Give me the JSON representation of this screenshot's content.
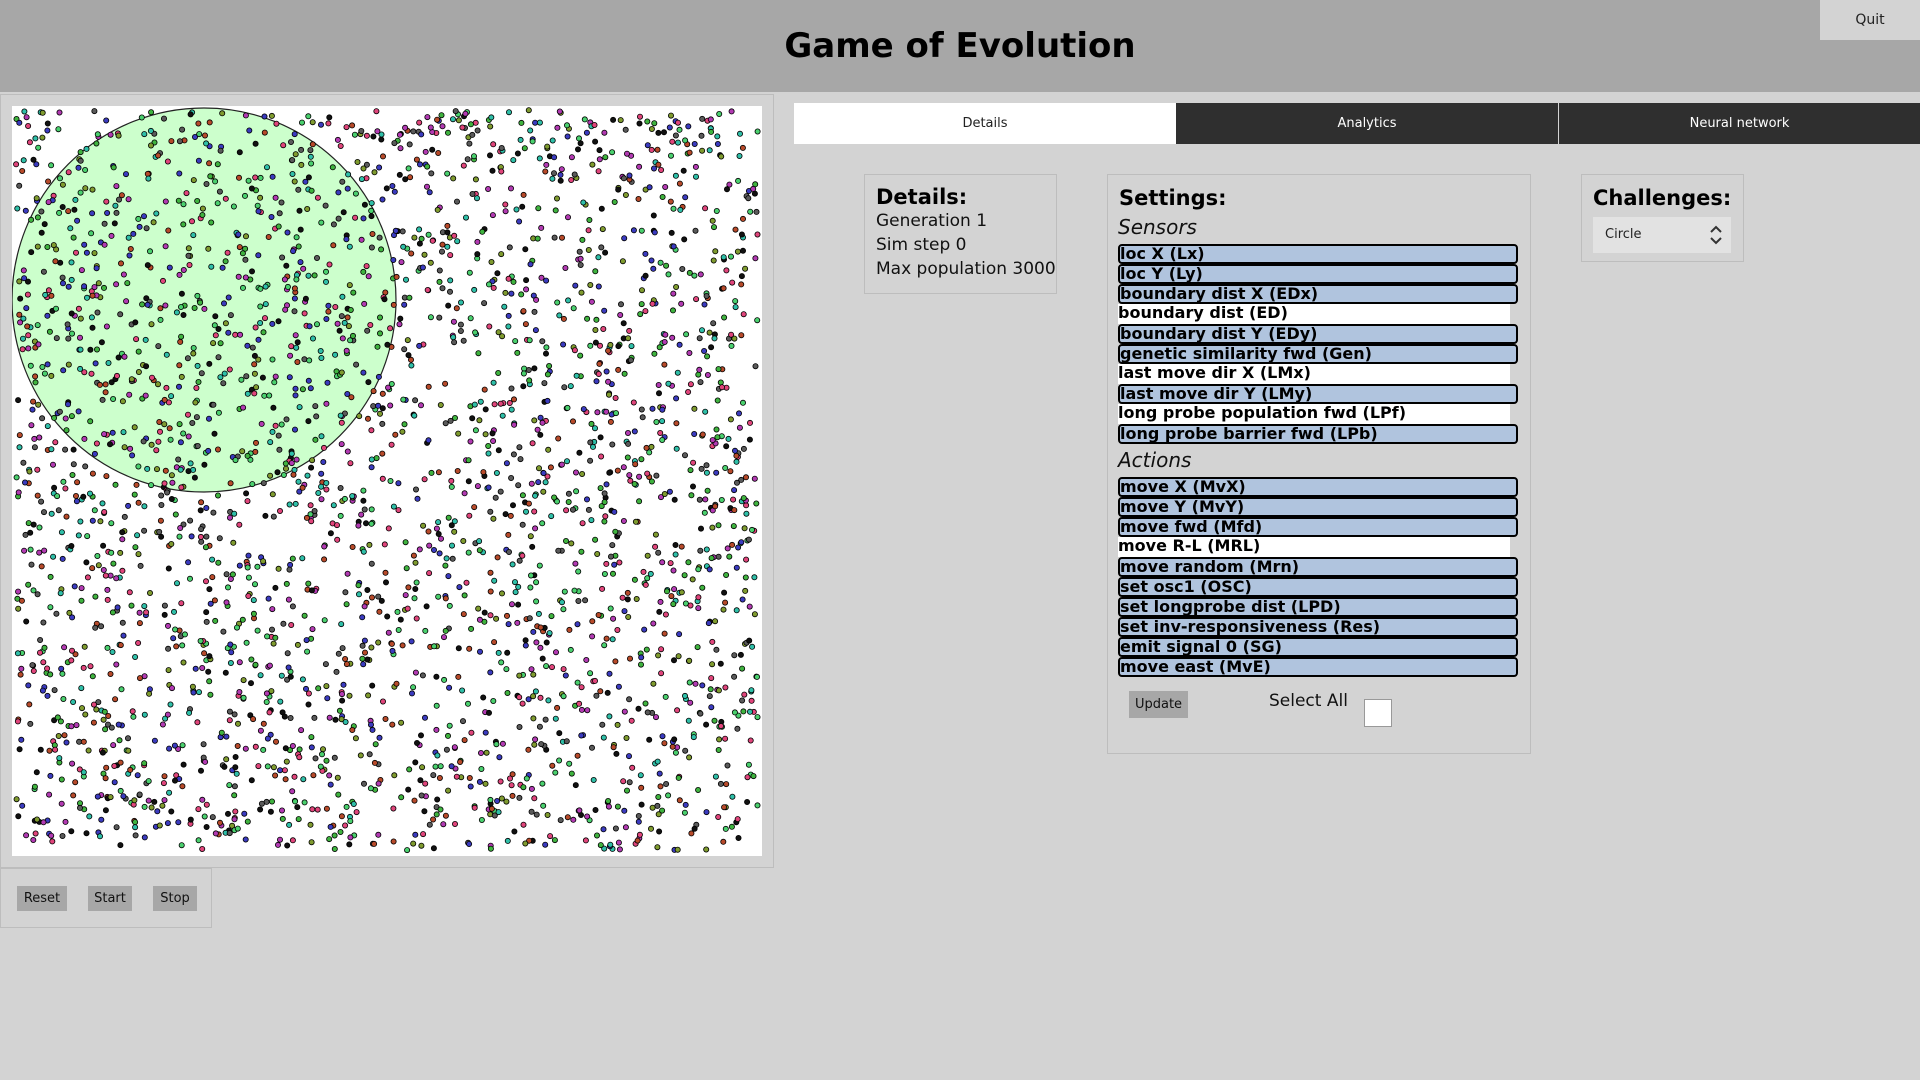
{
  "header": {
    "title": "Game of Evolution",
    "quit_label": "Quit"
  },
  "controls": {
    "reset_label": "Reset",
    "start_label": "Start",
    "stop_label": "Stop"
  },
  "tabs": [
    {
      "label": "Details",
      "active": true
    },
    {
      "label": "Analytics",
      "active": false
    },
    {
      "label": "Neural network",
      "active": false
    }
  ],
  "details": {
    "title": "Details:",
    "generation": "Generation 1",
    "sim_step": "Sim step 0",
    "max_population": "Max population 3000"
  },
  "settings": {
    "title": "Settings:",
    "sensors_label": "Sensors",
    "sensors": [
      {
        "label": "loc X (Lx)",
        "selected": true
      },
      {
        "label": "loc Y (Ly)",
        "selected": true
      },
      {
        "label": "boundary dist X (EDx)",
        "selected": true
      },
      {
        "label": "boundary dist (ED)",
        "selected": false
      },
      {
        "label": "boundary dist Y (EDy)",
        "selected": true
      },
      {
        "label": "genetic similarity fwd (Gen)",
        "selected": true
      },
      {
        "label": "last move dir X (LMx)",
        "selected": false
      },
      {
        "label": "last move dir Y (LMy)",
        "selected": true
      },
      {
        "label": "long probe population fwd (LPf)",
        "selected": false
      },
      {
        "label": "long probe barrier fwd (LPb)",
        "selected": true
      }
    ],
    "actions_label": "Actions",
    "actions": [
      {
        "label": "move X (MvX)",
        "selected": true
      },
      {
        "label": "move Y (MvY)",
        "selected": true
      },
      {
        "label": "move fwd (Mfd)",
        "selected": true
      },
      {
        "label": "move R-L (MRL)",
        "selected": false
      },
      {
        "label": "move random (Mrn)",
        "selected": true
      },
      {
        "label": "set osc1 (OSC)",
        "selected": true
      },
      {
        "label": "set longprobe dist (LPD)",
        "selected": true
      },
      {
        "label": "set inv-responsiveness (Res)",
        "selected": true
      },
      {
        "label": "emit signal 0 (SG)",
        "selected": true
      },
      {
        "label": "move east (MvE)",
        "selected": true
      }
    ],
    "update_label": "Update",
    "select_all_label": "Select All",
    "select_all_checked": false
  },
  "challenges": {
    "title": "Challenges:",
    "selected": "Circle"
  },
  "simulation": {
    "challenge_zone": "circle",
    "zone_color": "#ccffcc",
    "population_count": 3000,
    "agent_colors": [
      "#3fb33f",
      "#3b3bbf",
      "#b23ab2",
      "#b74a2a",
      "#2fbfa8",
      "#111111",
      "#7f9b2f",
      "#e0457b",
      "#4ad06e",
      "#5a5a5a"
    ]
  }
}
